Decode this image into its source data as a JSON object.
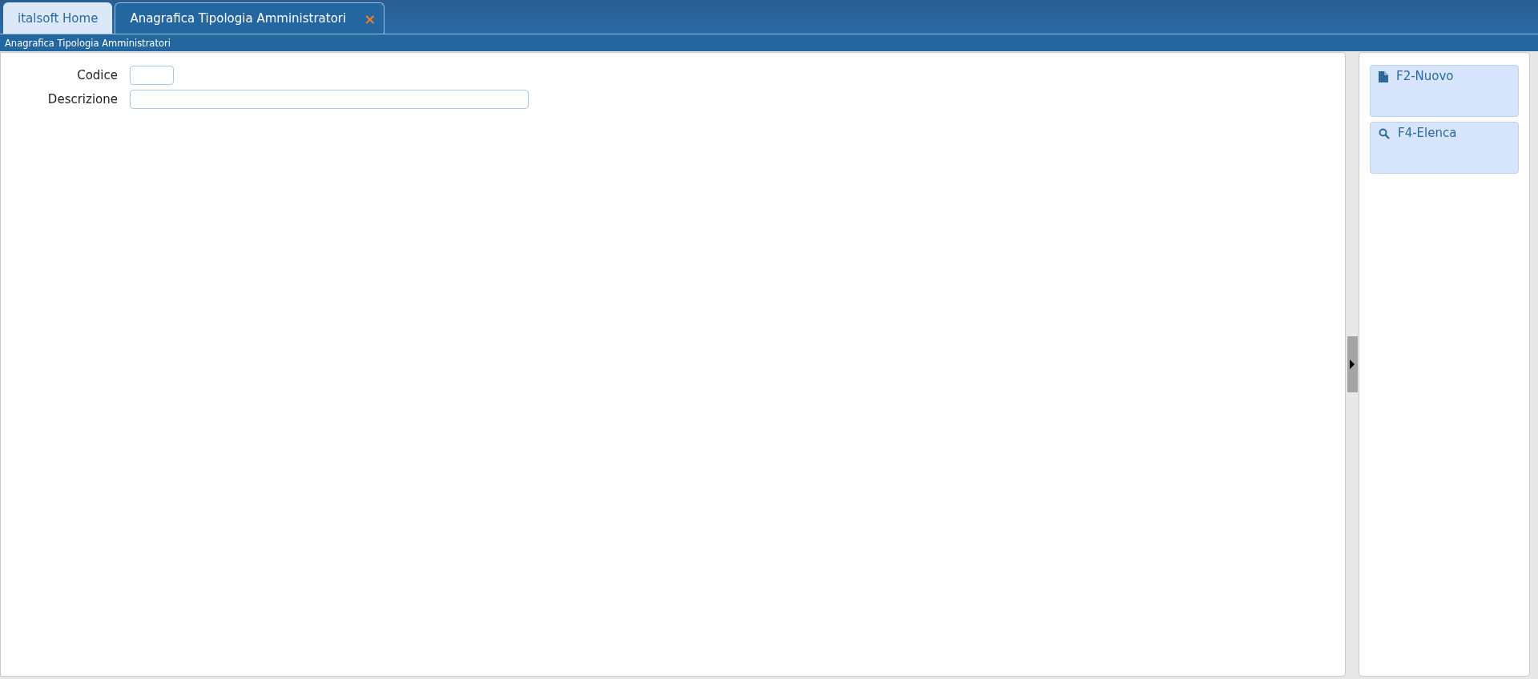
{
  "tabs": [
    {
      "label": "italsoft Home",
      "selected": false
    },
    {
      "label": "Anagrafica Tipologia Amministratori",
      "selected": true,
      "close": "×"
    }
  ],
  "breadcrumb": "Anagrafica Tipologia Amministratori",
  "form": {
    "fields": [
      {
        "label": "Codice",
        "kind": "short"
      },
      {
        "label": "Descrizione",
        "kind": "long"
      }
    ]
  },
  "actions": [
    {
      "label": "F2-Nuovo",
      "kind": "new"
    },
    {
      "label": "F4-Elenca",
      "kind": "search"
    }
  ]
}
